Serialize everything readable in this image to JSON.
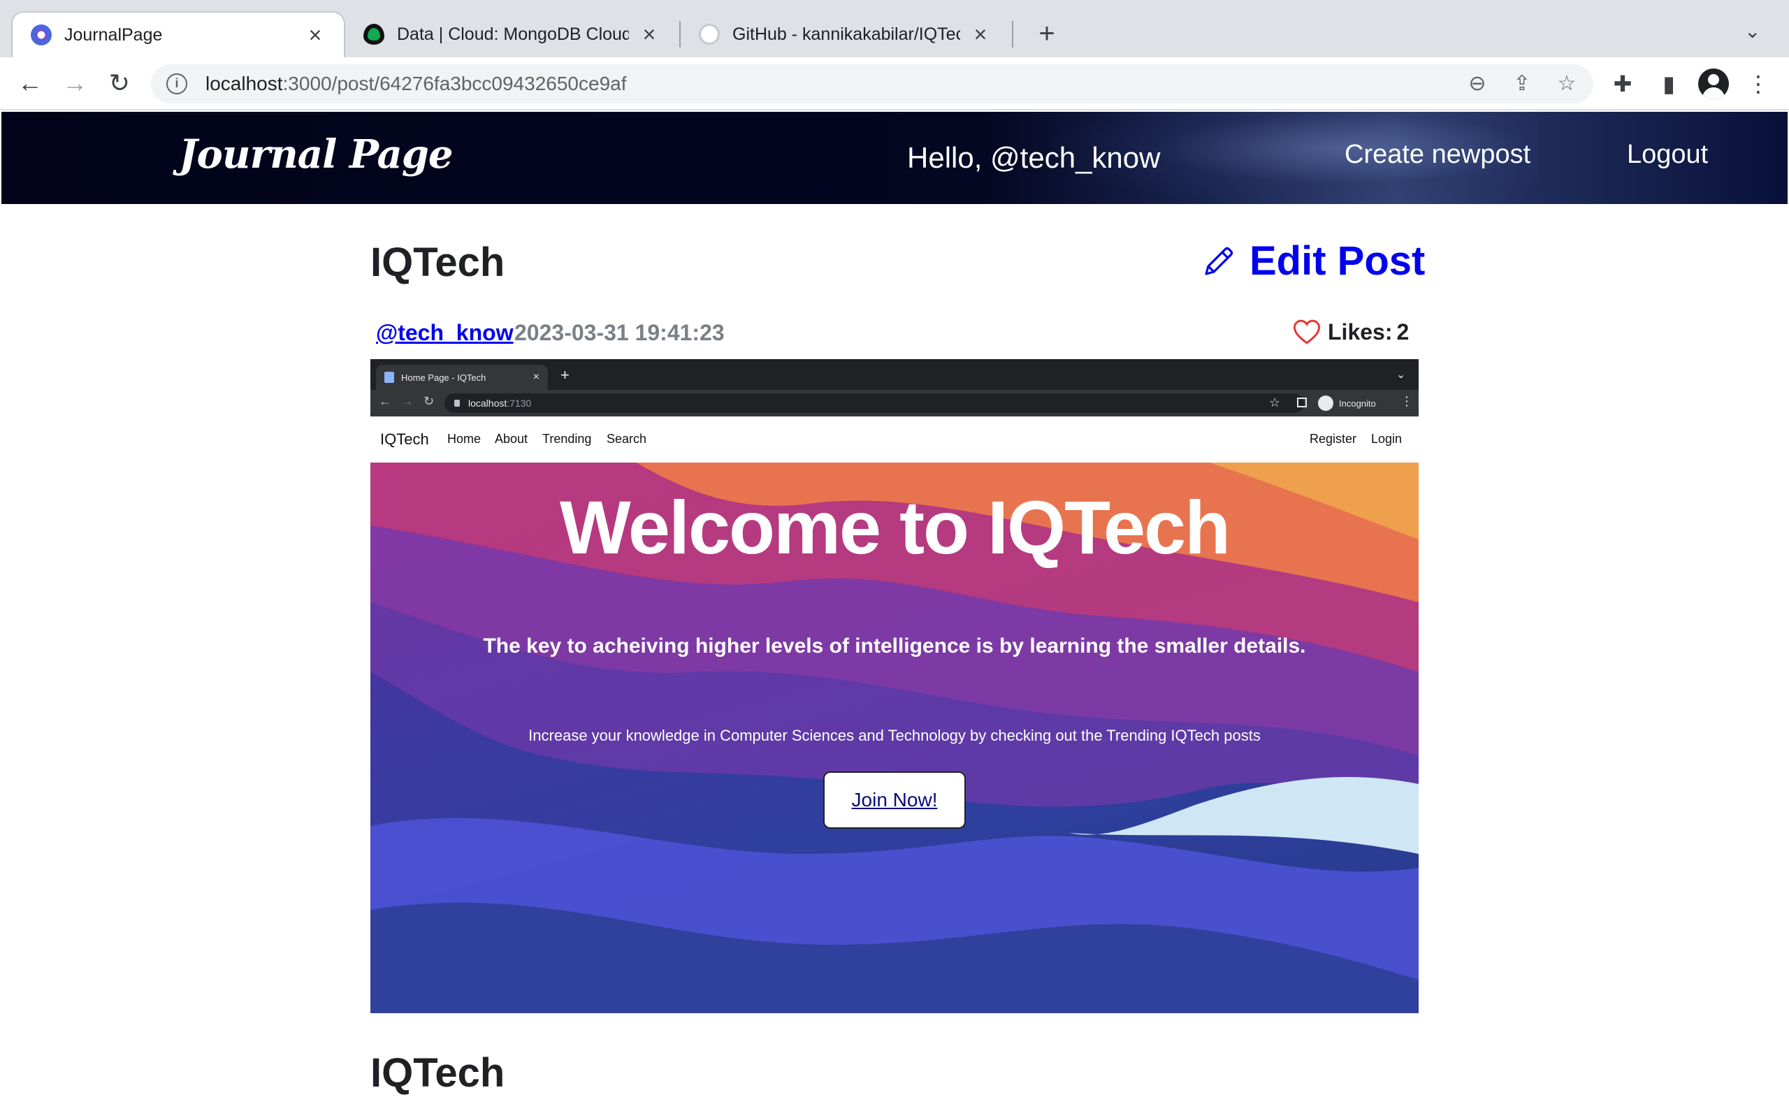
{
  "browser": {
    "tabs": [
      {
        "title": "JournalPage",
        "active": true
      },
      {
        "title": "Data | Cloud: MongoDB Cloud",
        "active": false
      },
      {
        "title": "GitHub - kannikakabilar/IQTech",
        "active": false
      }
    ],
    "url_host": "localhost",
    "url_rest": ":3000/post/64276fa3bcc09432650ce9af"
  },
  "header": {
    "logo": "Journal Page",
    "greeting": "Hello, @tech_know",
    "create_link": "Create newpost",
    "logout_link": "Logout"
  },
  "post": {
    "title": "IQTech",
    "edit_label": "Edit Post",
    "author": "@tech_know",
    "date": "2023-03-31 19:41:23",
    "likes_label": "Likes:",
    "likes_count": "2",
    "footer_title": "IQTech"
  },
  "screenshot": {
    "tab_title": "Home Page - IQTech",
    "url_host": "localhost",
    "url_rest": ":7130",
    "incognito": "Incognito",
    "brand": "IQTech",
    "nav": [
      "Home",
      "About",
      "Trending",
      "Search"
    ],
    "register": "Register",
    "login": "Login",
    "hero_title": "Welcome to IQTech",
    "hero_lead": "The key to acheiving higher levels of intelligence is by learning the smaller details.",
    "hero_sub": "Increase your knowledge in Computer Sciences and Technology by checking out the Trending IQTech posts",
    "join_label": "Join Now!"
  },
  "colors": {
    "link": "#0000ee",
    "header_bg": "#02031a",
    "heart": "#e53935"
  }
}
